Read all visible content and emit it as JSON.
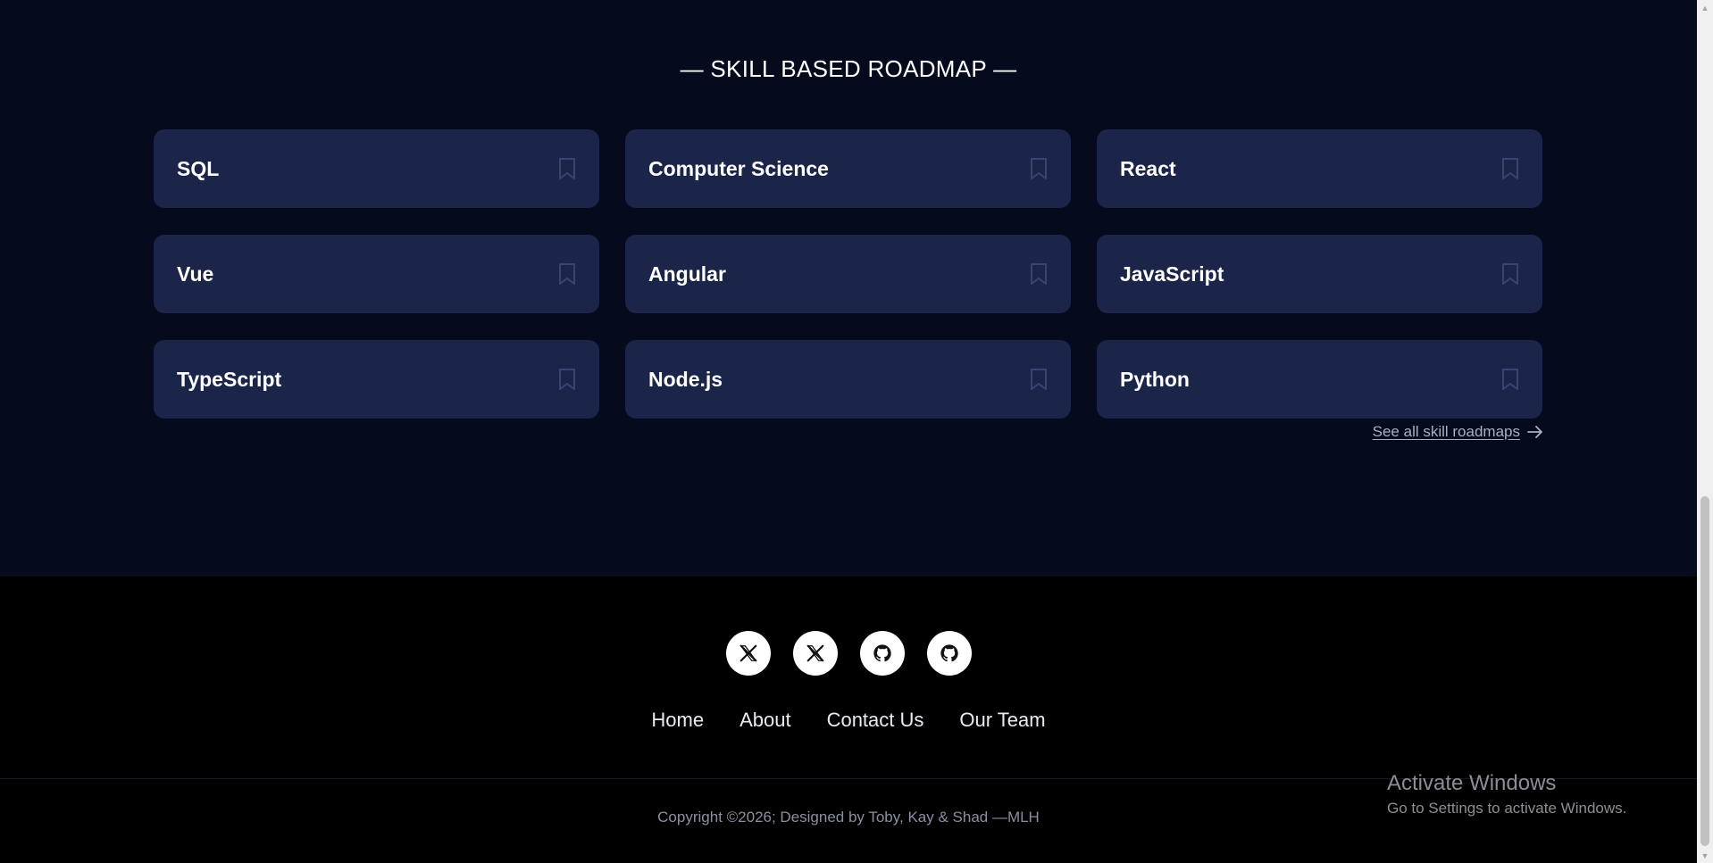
{
  "section": {
    "title": "— SKILL BASED ROADMAP —"
  },
  "roadmaps": [
    {
      "label": "SQL"
    },
    {
      "label": "Computer Science"
    },
    {
      "label": "React"
    },
    {
      "label": "Vue"
    },
    {
      "label": "Angular"
    },
    {
      "label": "JavaScript"
    },
    {
      "label": "TypeScript"
    },
    {
      "label": "Node.js"
    },
    {
      "label": "Python"
    }
  ],
  "see_all": {
    "label": "See all skill roadmaps"
  },
  "footer": {
    "socials": [
      {
        "icon": "x-twitter-icon"
      },
      {
        "icon": "x-twitter-icon"
      },
      {
        "icon": "github-icon"
      },
      {
        "icon": "github-icon"
      }
    ],
    "nav": [
      {
        "label": "Home"
      },
      {
        "label": "About"
      },
      {
        "label": "Contact Us"
      },
      {
        "label": "Our Team"
      }
    ],
    "copyright": "Copyright ©2026; Designed by Toby, Kay & Shad —MLH"
  },
  "watermark": {
    "title": "Activate Windows",
    "subtitle": "Go to Settings to activate Windows."
  },
  "colors": {
    "page_bg": "#050a1c",
    "card_bg": "#1b2449",
    "footer_bg": "#000000",
    "bookmark": "#3a4470"
  }
}
